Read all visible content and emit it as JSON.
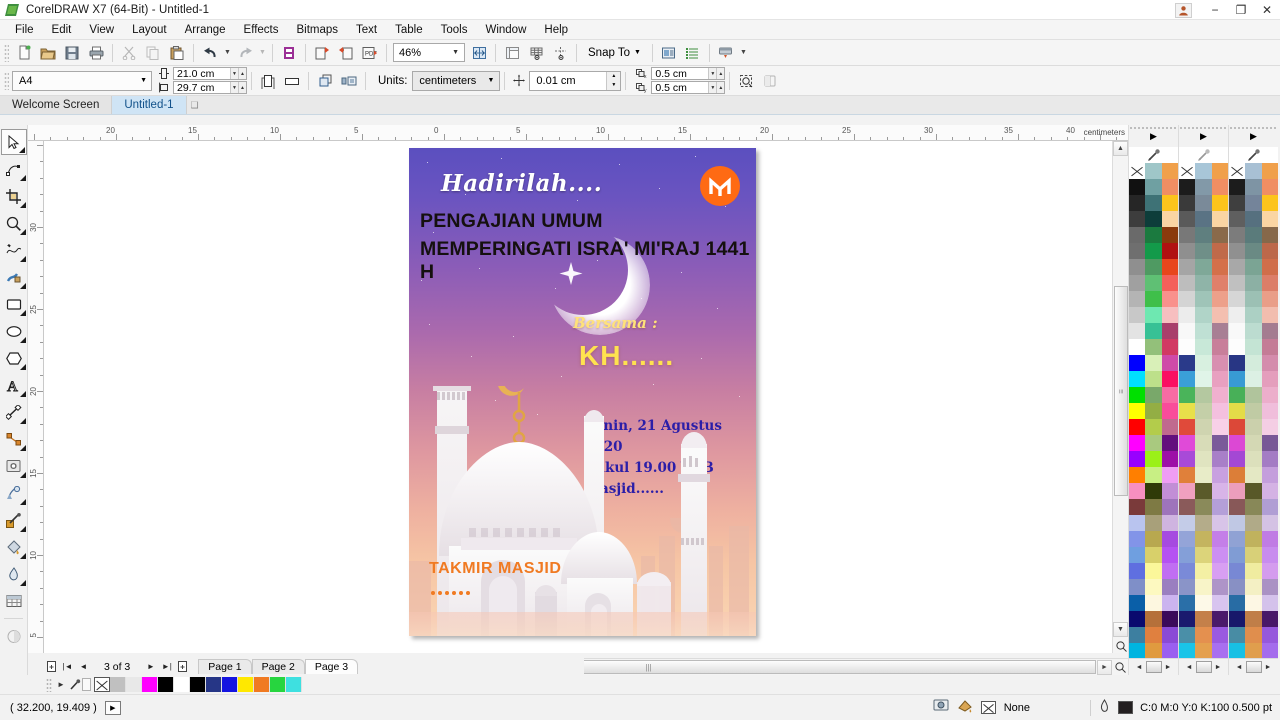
{
  "window": {
    "title": "CorelDRAW X7 (64-Bit) - Untitled-1",
    "app_icon": "coreldraw-logo-icon",
    "controls": {
      "user": "user-account-icon",
      "minimize": "−",
      "restore": "❐",
      "close": "✕"
    }
  },
  "menubar": {
    "items": [
      {
        "label": "File",
        "accel": "F"
      },
      {
        "label": "Edit",
        "accel": "E"
      },
      {
        "label": "View",
        "accel": "V"
      },
      {
        "label": "Layout",
        "accel": "L"
      },
      {
        "label": "Arrange",
        "accel": "A"
      },
      {
        "label": "Effects",
        "accel": "c"
      },
      {
        "label": "Bitmaps",
        "accel": "B"
      },
      {
        "label": "Text",
        "accel": "x"
      },
      {
        "label": "Table",
        "accel": "T"
      },
      {
        "label": "Tools",
        "accel": "o"
      },
      {
        "label": "Window",
        "accel": "W"
      },
      {
        "label": "Help",
        "accel": "H"
      }
    ]
  },
  "toolbar": {
    "buttons": [
      "new-document-icon",
      "open-document-icon",
      "save-document-icon",
      "print-icon",
      "cut-icon",
      "copy-icon",
      "paste-icon",
      "undo-icon",
      "redo-icon",
      "search-content-icon",
      "import-icon",
      "export-icon",
      "publish-pdf-icon"
    ],
    "zoom_level": "46%",
    "zoom_dropdown_icon": "chevron-down-icon",
    "full_screen_preview_icon": "full-screen-preview-icon",
    "show_rulers_icon": "show-rulers-icon",
    "show_grid_icon": "show-grid-icon",
    "show_guides_icon": "show-guides-icon",
    "snap_to_label": "Snap To",
    "snap_to_caret": "chevron-down-icon",
    "options_icon": "options-icon",
    "object-manager_icon": "object-manager-icon",
    "application_launcher_icon": "application-launcher-icon"
  },
  "propertybar": {
    "page_size": "A4",
    "page_size_caret": "chevron-down-icon",
    "page_width": "21.0 cm",
    "page_height": "29.7 cm",
    "orientation_portrait_icon": "portrait-orientation-icon",
    "orientation_landscape_icon": "landscape-orientation-icon",
    "all_pages_icon": "apply-all-pages-icon",
    "current_page_icon": "apply-current-page-icon",
    "units_label": "Units:",
    "units_value": "centimeters",
    "units_caret": "chevron-down-icon",
    "nudge_icon": "nudge-offset-icon",
    "nudge_value": "0.01 cm",
    "duplicate_x_label": "duplicate-distance-x-icon",
    "duplicate_x": "0.5 cm",
    "duplicate_y_label": "duplicate-distance-y-icon",
    "duplicate_y": "0.5 cm",
    "treat_as_filled_icon": "treat-as-filled-icon",
    "wireframe_icon": "wireframe-icon"
  },
  "doctabs": {
    "tabs": [
      {
        "label": "Welcome Screen",
        "active": false
      },
      {
        "label": "Untitled-1",
        "active": true
      }
    ],
    "close_icon": "close-tab-icon"
  },
  "toolbox": {
    "tools": [
      {
        "name": "pick-tool",
        "glyph": "pick",
        "active": true,
        "flyout": true
      },
      {
        "name": "shape-tool",
        "glyph": "shape",
        "active": false,
        "flyout": true
      },
      {
        "name": "crop-tool",
        "glyph": "crop",
        "active": false,
        "flyout": true
      },
      {
        "name": "zoom-tool",
        "glyph": "zoom",
        "active": false,
        "flyout": true
      },
      {
        "name": "freehand-tool",
        "glyph": "freehand",
        "active": false,
        "flyout": true
      },
      {
        "name": "artistic-media-tool",
        "glyph": "artmedia",
        "active": false,
        "flyout": true
      },
      {
        "name": "rectangle-tool",
        "glyph": "rect",
        "active": false,
        "flyout": true
      },
      {
        "name": "ellipse-tool",
        "glyph": "ellipse",
        "active": false,
        "flyout": true
      },
      {
        "name": "polygon-tool",
        "glyph": "polygon",
        "active": false,
        "flyout": true
      },
      {
        "name": "text-tool",
        "glyph": "text",
        "active": false,
        "flyout": true
      },
      {
        "name": "parallel-dimension-tool",
        "glyph": "dimension",
        "active": false,
        "flyout": true
      },
      {
        "name": "straight-line-connector-tool",
        "glyph": "connector",
        "active": false,
        "flyout": true
      },
      {
        "name": "drop-shadow-tool",
        "glyph": "shadow",
        "active": false,
        "flyout": true
      },
      {
        "name": "transparency-tool",
        "glyph": "transparency",
        "active": false,
        "flyout": false
      },
      {
        "name": "color-eyedropper-tool",
        "glyph": "eyedropper",
        "active": false,
        "flyout": true
      },
      {
        "name": "smart-fill-tool",
        "glyph": "smartfill",
        "active": false,
        "flyout": true
      },
      {
        "name": "interactive-fill-tool",
        "glyph": "fill",
        "active": false,
        "flyout": true
      },
      {
        "name": "table-tool",
        "glyph": "table",
        "active": false,
        "flyout": false
      },
      {
        "name": "transparency-docker-tool",
        "glyph": "halfcircle",
        "active": false,
        "flyout": false
      }
    ]
  },
  "rulers": {
    "unit_label": "centimeters",
    "horizontal_ticks": [
      "20",
      "15",
      "10",
      "5",
      "0",
      "5",
      "10",
      "15",
      "20",
      "25",
      "30",
      "35",
      "40"
    ],
    "vertical_ticks": [
      "30",
      "25",
      "20",
      "15",
      "10",
      "5"
    ],
    "vertical_unit_label": "centimeters"
  },
  "poster": {
    "hadirilah": "Hadirilah....",
    "heading1": "PENGAJIAN UMUM",
    "heading2": "MEMPERINGATI ISRA' MI'RAJ 1441 H",
    "bersama": "Bersama :",
    "speaker": "KH......",
    "date": "Senin,  21  Agustus  2020",
    "time": "Pukul 19.00 WIB",
    "place": "Masjid......",
    "organizer": "TAKMIR MASJID",
    "logo_letter": "M",
    "logo_color": "#ff6a13",
    "accent_color": "#f07a22",
    "speaker_color": "#ffe24f",
    "info_color": "#2b1ea8",
    "icons": {
      "crescent": "crescent-moon-icon",
      "logo": "mosque-logo-icon"
    }
  },
  "pagenav": {
    "add_page_start_icon": "add-page-before-icon",
    "first_icon": "first-page-icon",
    "prev_icon": "previous-page-icon",
    "counter": "3 of 3",
    "next_icon": "next-page-icon",
    "last_icon": "last-page-icon",
    "add_page_end_icon": "add-page-after-icon",
    "pages": [
      {
        "label": "Page 1",
        "active": false
      },
      {
        "label": "Page 2",
        "active": false
      },
      {
        "label": "Page 3",
        "active": true
      }
    ]
  },
  "palette": {
    "eyedropper_icon": "color-eyedropper-icon",
    "expand_icon": "palette-expand-icon",
    "scroll_left_icon": "◄",
    "scroll_right_icon": "►",
    "columns": [
      [
        "#ffffff",
        "#9fc6c8",
        "#f0a04b",
        "#111111",
        "#6fa0a2",
        "#f08e63",
        "#262626",
        "#3e7276",
        "#fcc41c",
        "#3d3d3d",
        "#0d3d3a",
        "#fad5a3",
        "#6a6a6a",
        "#1b7a3f",
        "#8a3a0c",
        "#6f6f6f",
        "#139a4a",
        "#b01111",
        "#8f8f8f",
        "#4f9a62",
        "#e8461c",
        "#a0a0a0",
        "#5fc074",
        "#f4605a",
        "#b4b4b4",
        "#3fbf4a",
        "#f9918c",
        "#c8c8c8",
        "#6ee8b1",
        "#f7bfc0",
        "#e3e3e3",
        "#37c195",
        "#a83f6b",
        "#ffffff",
        "#93c07a",
        "#d13a63",
        "#0000ff",
        "#d9f0b8",
        "#cf4aa8",
        "#00e0ff",
        "#bde08a",
        "#fa0f62",
        "#00e000",
        "#79a86a",
        "#f76ba3",
        "#ffff00",
        "#93ae44",
        "#f94c9a",
        "#ff0000",
        "#b3cc4b",
        "#c06a8e",
        "#ff00ff",
        "#a9c97f",
        "#63107d",
        "#9900ff",
        "#9bf018",
        "#9d0fa7",
        "#ff7f00",
        "#c8ef84",
        "#ef9df4",
        "#f78fc0",
        "#2f3a08",
        "#c28ed6",
        "#7a3a3a",
        "#7e7a44",
        "#9e74bb",
        "#b9c4ef",
        "#a8a07a",
        "#cfb4e0",
        "#8294e8",
        "#b8a84f",
        "#a64ae0",
        "#6f9fe0",
        "#d8d06a",
        "#b552f2",
        "#5f6fe0",
        "#fbf79a",
        "#c06ef2",
        "#7f8fc8",
        "#fdf9c0",
        "#9a7fc0",
        "#0a5fa8",
        "#fdf7e0",
        "#cbb4ef",
        "#0a0a6e",
        "#b5703a",
        "#3a0a5a",
        "#3d7fa0",
        "#e0803f",
        "#8a4ad6",
        "#00b4e0",
        "#e09a3f",
        "#9a5ff0",
        "#a8e8f8",
        "#f4603a",
        "#8a00f0"
      ],
      [
        "#ffffff",
        "#a8c6d8",
        "#f0a04b",
        "#1c1c1c",
        "#8299a8",
        "#f08e63",
        "#3a3a3a",
        "#7a8a99",
        "#fcc41c",
        "#5a5a5a",
        "#5a7384",
        "#fad5a3",
        "#787878",
        "#5f7f7f",
        "#8a6a4a",
        "#8f8f8f",
        "#6f8f88",
        "#c06a4a",
        "#a5a5a5",
        "#7fa898",
        "#d4704a",
        "#bdbdbd",
        "#8fb4a8",
        "#e0806a",
        "#d4d4d4",
        "#9fc4b8",
        "#eda08a",
        "#ececec",
        "#b0d4c8",
        "#f4bfb0",
        "#f8f8f8",
        "#bfe0d4",
        "#a87f94",
        "#fdfdfd",
        "#c8e8d8",
        "#c87f9a",
        "#2a3a8a",
        "#d8f0e0",
        "#d88fb0",
        "#3a9fd8",
        "#e0f4e8",
        "#e8a0c0",
        "#4ab45a",
        "#b4c8a0",
        "#f0b0cf",
        "#e8e04a",
        "#c4cfa8",
        "#f4c0df",
        "#e04a3a",
        "#cfd4b0",
        "#f8d0e8",
        "#e04ad8",
        "#d8dcb8",
        "#7a5a9a",
        "#a84ad8",
        "#e0e4c0",
        "#a87fc8",
        "#e0803a",
        "#e8ecc8",
        "#c8a0e0",
        "#f0a0c0",
        "#5a5a2a",
        "#d8b4e8",
        "#8a5a5a",
        "#8a8a5a",
        "#b49fd8",
        "#c4cce8",
        "#b4ac8a",
        "#d8c4e8",
        "#94a4d8",
        "#c4b45f",
        "#c47fe8",
        "#849fd8",
        "#dcd47a",
        "#cc8ff2",
        "#7a8ad8",
        "#f4f0a4",
        "#d89ff2",
        "#8a94c8",
        "#f8f4c8",
        "#ae94c8",
        "#2a6fa8",
        "#fdf9e8",
        "#d8c4ef",
        "#1a1a6e",
        "#c4804a",
        "#4a1a6a",
        "#4a8fa8",
        "#e4904f",
        "#9a5ae0",
        "#1ac4e8",
        "#e4a04f",
        "#a86ff0",
        "#b4ecf8",
        "#f8704a",
        "#9a1af0"
      ],
      [
        "#ffffff",
        "#a8c0d4",
        "#f0a04b",
        "#1c1c1c",
        "#7e94a4",
        "#f08e63",
        "#3f3f3f",
        "#74849a",
        "#fcc41c",
        "#5f5f5f",
        "#56707f",
        "#fad5a3",
        "#7c7c7c",
        "#5a7b7b",
        "#86684a",
        "#909090",
        "#6a8a84",
        "#bc684a",
        "#a8a8a8",
        "#7ba494",
        "#d06e4a",
        "#c0c0c0",
        "#8cb0a4",
        "#dc7e68",
        "#d6d6d6",
        "#9cc0b4",
        "#e99e88",
        "#eeeeee",
        "#acd0c4",
        "#f2bdae",
        "#f9f9f9",
        "#bcdcd0",
        "#a47c90",
        "#fdfdfd",
        "#c4e4d4",
        "#c47c96",
        "#283684",
        "#d4ecdc",
        "#d48cac",
        "#389ad4",
        "#dcf0e4",
        "#e49ebc",
        "#48b058",
        "#b0c49c",
        "#ecaecb",
        "#e4dc48",
        "#c0cba4",
        "#f0bedb",
        "#dc4838",
        "#cbd0ac",
        "#f4cee4",
        "#dc48d4",
        "#d4d8b4",
        "#785896",
        "#a448d4",
        "#dce0bc",
        "#a47cc4",
        "#dc7e38",
        "#e4e8c4",
        "#c49edc",
        "#ec9ebc",
        "#585828",
        "#d4b2e4",
        "#885858",
        "#888858",
        "#b09ed4",
        "#c0c8e4",
        "#b0aa88",
        "#d4c2e4",
        "#90a2d4",
        "#c0b25d",
        "#c07ce4",
        "#809cd4",
        "#d8d078",
        "#c88cee",
        "#7888d4",
        "#f0ecA0",
        "#d49cee",
        "#8890c4",
        "#f4f0c4",
        "#aa92c4",
        "#286ca4",
        "#fdf7e4",
        "#d4c2eb",
        "#18186a",
        "#c07e48",
        "#481868",
        "#488ca4",
        "#e08e4d",
        "#9658dc",
        "#18c0e4",
        "#e09e4d",
        "#a46cec",
        "#b0e8f4",
        "#f46e48",
        "#9618ec"
      ]
    ]
  },
  "bottompalette": {
    "expand_icon": "►",
    "eyedropper_icon": "eyedropper-icon",
    "swatches": [
      "none",
      "#c0c0c0",
      "#e8e8e8",
      "#ff00ff",
      "#000000",
      "#ffffff",
      "#000000",
      "#263686",
      "#1414e0",
      "#ffe800",
      "#f07a22",
      "#27d53f",
      "#3ee0e0"
    ]
  },
  "statusbar": {
    "coordinates": "( 32.200, 19.409 )",
    "play_icon": "▶",
    "monitor_icon": "color-proof-icon",
    "fill_icon": "fill-color-icon",
    "fill_value": "None",
    "outline_icon": "outline-pen-icon",
    "outline_value": "C:0 M:0 Y:0 K:100  0.500 pt",
    "outline_color": "#231f20"
  }
}
